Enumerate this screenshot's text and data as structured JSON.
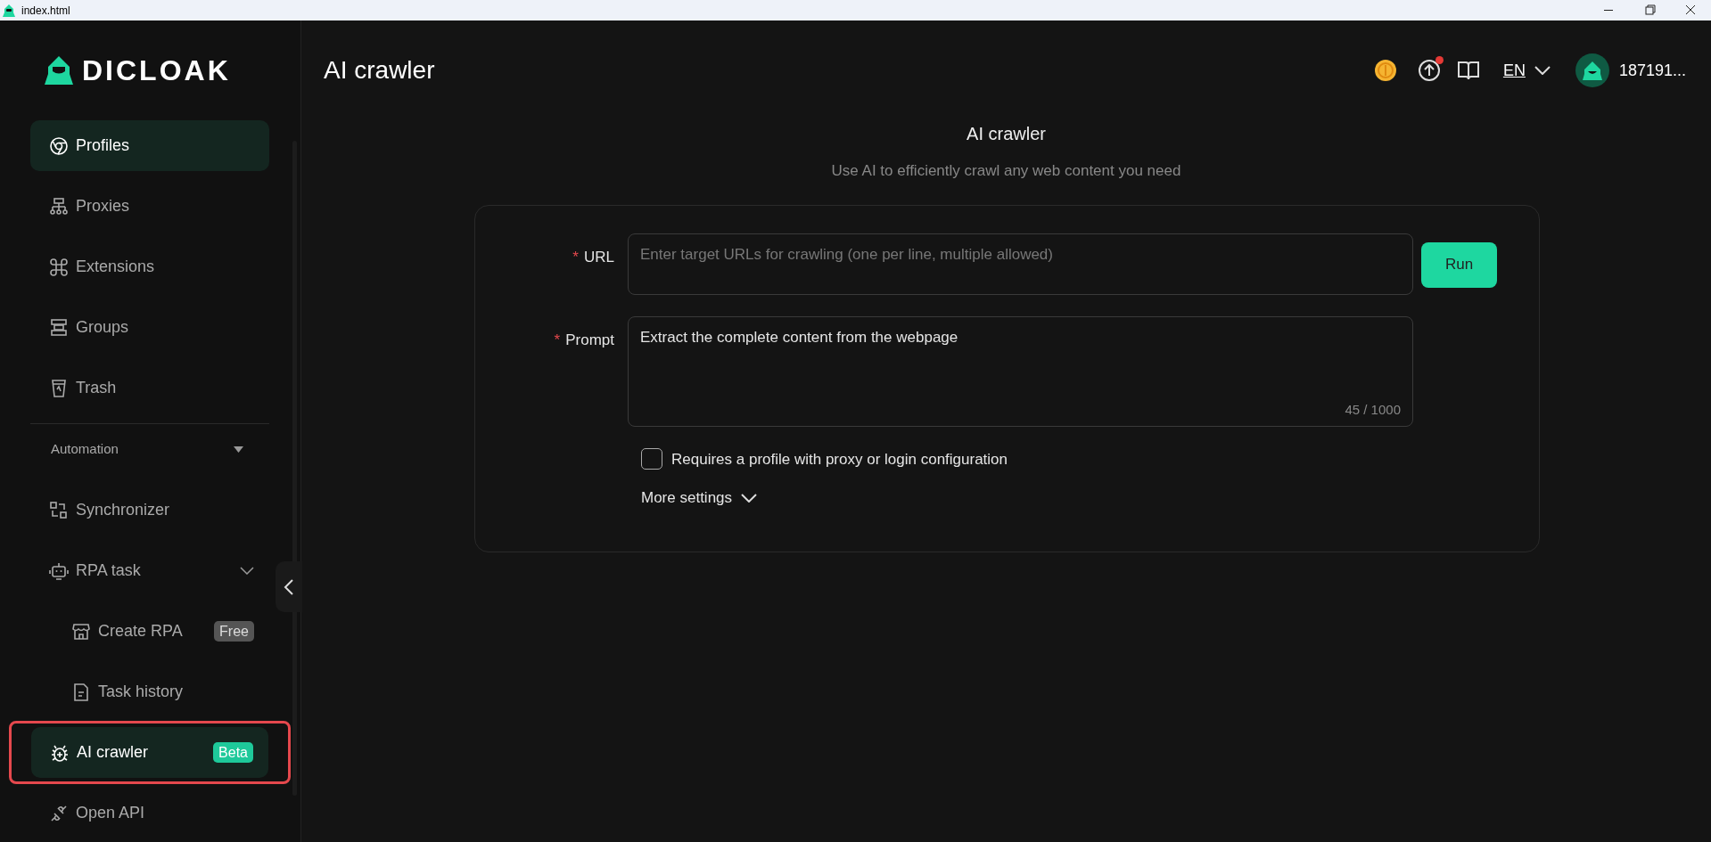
{
  "window": {
    "title": "index.html"
  },
  "logo_text": "DICLOAK",
  "sidebar": {
    "items": [
      {
        "label": "Profiles",
        "selected": true
      },
      {
        "label": "Proxies",
        "selected": false
      },
      {
        "label": "Extensions",
        "selected": false
      },
      {
        "label": "Groups",
        "selected": false
      },
      {
        "label": "Trash",
        "selected": false
      }
    ],
    "section": {
      "label": "Automation",
      "expanded": true,
      "items": [
        {
          "label": "Synchronizer",
          "selected": false
        },
        {
          "label": "RPA task",
          "selected": false,
          "expanded": true,
          "children": [
            {
              "label": "Create RPA",
              "selected": false,
              "badge": {
                "text": "Free",
                "kind": "free"
              }
            },
            {
              "label": "Task history",
              "selected": false
            }
          ]
        },
        {
          "label": "AI crawler",
          "selected": true,
          "highlighted": true,
          "badge": {
            "text": "Beta",
            "kind": "beta"
          }
        },
        {
          "label": "Open API",
          "selected": false
        }
      ]
    }
  },
  "header": {
    "title": "AI crawler",
    "language": "EN",
    "user": "187191...",
    "notification": true
  },
  "content": {
    "title": "AI crawler",
    "subtitle": "Use AI to efficiently crawl any web content you need",
    "form": {
      "url": {
        "label": "URL",
        "required_mark": "*",
        "placeholder": "Enter target URLs for crawling (one per line, multiple allowed)"
      },
      "prompt": {
        "label": "Prompt",
        "required_mark": "*",
        "value": "Extract the complete content from the webpage",
        "counter": "45 / 1000"
      },
      "run_button": "Run",
      "checkbox": {
        "label": "Requires a profile with proxy or login configuration",
        "checked": false
      },
      "more_settings": {
        "label": "More settings",
        "expanded": false
      }
    }
  }
}
